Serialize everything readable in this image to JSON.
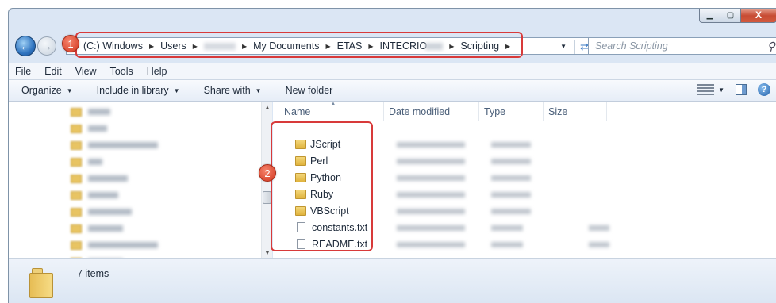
{
  "window": {
    "min_glyph": "▁",
    "max_glyph": "▢",
    "close_glyph": "X"
  },
  "address": {
    "overflow": "«",
    "segments": [
      "(C:) Windows",
      "Users",
      "",
      "My Documents",
      "ETAS",
      "INTECRIO",
      "Scripting"
    ]
  },
  "search": {
    "placeholder": "Search Scripting"
  },
  "menu": [
    "File",
    "Edit",
    "View",
    "Tools",
    "Help"
  ],
  "toolbar": {
    "organize": "Organize",
    "include": "Include in library",
    "share": "Share with",
    "newfolder": "New folder"
  },
  "columns": {
    "name": "Name",
    "date": "Date modified",
    "type": "Type",
    "size": "Size"
  },
  "files": [
    {
      "name": "JScript",
      "icon": "folder-icon"
    },
    {
      "name": "Perl",
      "icon": "folder-icon"
    },
    {
      "name": "Python",
      "icon": "folder-icon"
    },
    {
      "name": "Ruby",
      "icon": "folder-icon"
    },
    {
      "name": "VBScript",
      "icon": "folder-icon"
    },
    {
      "name": "constants.txt",
      "icon": "text-file-icon"
    },
    {
      "name": "README.txt",
      "icon": "text-file-icon"
    }
  ],
  "status": {
    "items": "7 items"
  },
  "annotations": {
    "badge1": "1",
    "badge2": "2",
    "color": "#d83a3a"
  }
}
